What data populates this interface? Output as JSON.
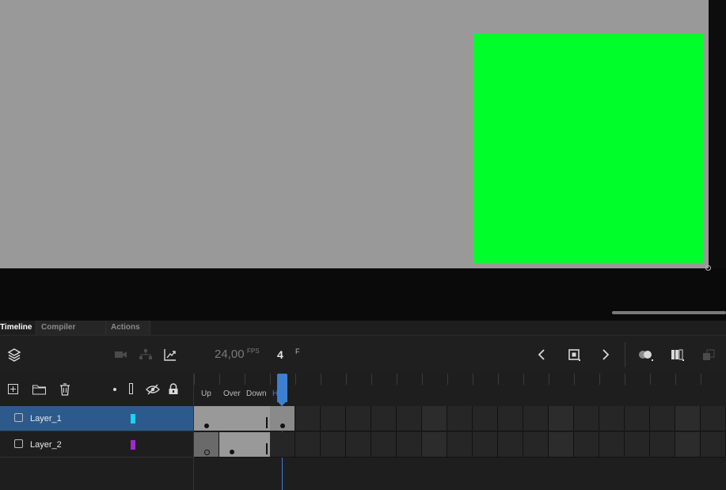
{
  "tabs": [
    {
      "label": "Timeline",
      "active": true
    },
    {
      "label": "Compiler Errors",
      "active": false
    },
    {
      "label": "Actions",
      "active": false
    }
  ],
  "toolbar": {
    "fps_value": "24,00",
    "fps_label": "FPS",
    "current_frame": "4",
    "frame_unit": "F"
  },
  "frame_labels": [
    "Up",
    "Over",
    "Down",
    "Hit"
  ],
  "layers": [
    {
      "name": "Layer_1",
      "color": "#17d4f0",
      "selected": true
    },
    {
      "name": "Layer_2",
      "color": "#a02ad0",
      "selected": false
    }
  ],
  "colors": {
    "stage_bg": "#999999",
    "shape_fill": "#00ff2a",
    "selection": "#2d5a8c",
    "playhead": "#3d7fd0"
  },
  "icons": {
    "layers": "layers-icon",
    "camera": "camera-icon",
    "hierarchy": "hierarchy-icon",
    "graph": "graph-icon",
    "add_layer": "add-layer-icon",
    "folder": "folder-icon",
    "delete": "trash-icon",
    "dot": "dot-icon",
    "outline": "outline-icon",
    "eye": "eye-hide-icon",
    "lock": "lock-icon",
    "prev": "chevron-left-icon",
    "keyframe": "keyframe-icon",
    "next": "chevron-right-icon",
    "onion": "onion-skin-icon",
    "edit_multiple": "edit-multiple-frames-icon",
    "more": "more-icon"
  }
}
